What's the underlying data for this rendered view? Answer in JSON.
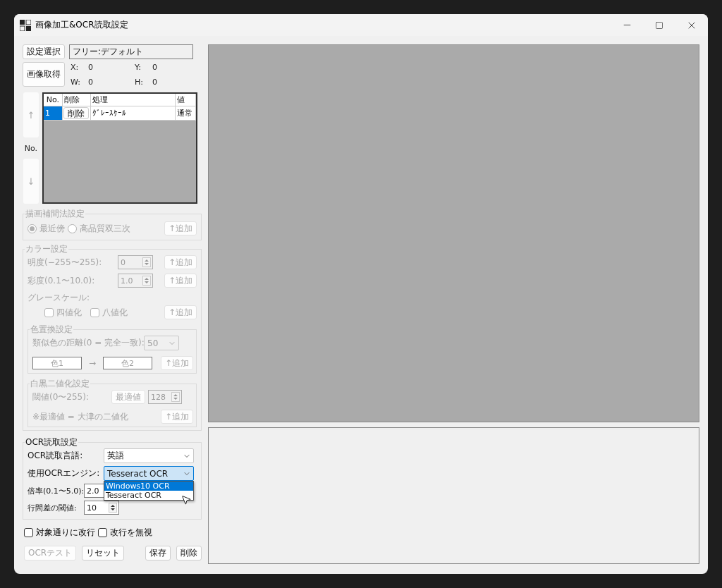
{
  "window": {
    "title": "画像加工&OCR読取設定"
  },
  "settings": {
    "select_button": "設定選択",
    "preset": "フリー:デフォルト",
    "capture_button": "画像取得",
    "coords": [
      {
        "label": "X:",
        "value": "0"
      },
      {
        "label": "Y:",
        "value": "0"
      },
      {
        "label": "W:",
        "value": "0"
      },
      {
        "label": "H:",
        "value": "0"
      }
    ]
  },
  "order": {
    "up": "↑",
    "label": "No.",
    "down": "↓",
    "disabled": true
  },
  "table": {
    "columns": [
      "No.",
      "削除",
      "処理",
      "値"
    ],
    "rows": [
      {
        "no": "1",
        "delete": "削除",
        "process": "ｸﾞﾚｰｽｹｰﾙ",
        "value": "通常",
        "selected": true
      }
    ]
  },
  "interpolation": {
    "title": "描画補間法設定",
    "disabled": true,
    "options": [
      {
        "label": "最近傍",
        "selected": true
      },
      {
        "label": "高品質双三次",
        "selected": false
      }
    ],
    "add": "↑追加"
  },
  "color": {
    "title": "カラー設定",
    "disabled": true,
    "brightness": {
      "label": "明度(−255〜255):",
      "value": "0",
      "add": "↑追加"
    },
    "saturation": {
      "label": "彩度(0.1〜10.0):",
      "value": "1.0",
      "add": "↑追加"
    },
    "grayscale": {
      "label": "グレースケール:",
      "options": [
        {
          "label": "四値化",
          "checked": false
        },
        {
          "label": "八値化",
          "checked": false
        }
      ],
      "add": "↑追加"
    },
    "replace": {
      "title": "色置換設定",
      "distance_label": "類似色の距離(0 = 完全一致):",
      "distance": "50",
      "color1": "色1",
      "arrow": "→",
      "color2": "色2",
      "add": "↑追加"
    },
    "binarize": {
      "title": "白黒二値化設定",
      "threshold_label": "閾値(0〜255):",
      "optimal": "最適値",
      "threshold": "128",
      "note": "※最適値 = 大津の二値化",
      "add": "↑追加"
    }
  },
  "ocr": {
    "title": "OCR読取設定",
    "language_label": "OCR読取言語:",
    "language": "英語",
    "engine_label": "使用OCRエンジン:",
    "engine": "Tesseract OCR",
    "engine_open": true,
    "engine_options": [
      {
        "label": "Windows10 OCR",
        "selected": true
      },
      {
        "label": "Tesseract OCR",
        "selected": false
      }
    ],
    "scale_label": "倍率(0.1〜5.0):",
    "scale": "2.0",
    "line_gap_label": "行間差の閾値:",
    "line_gap": "10"
  },
  "options": [
    {
      "label": "対象通りに改行",
      "checked": false
    },
    {
      "label": "改行を無視",
      "checked": false
    }
  ],
  "buttons": [
    {
      "label": "OCRテスト",
      "disabled": true
    },
    {
      "label": "リセット",
      "disabled": false
    },
    {
      "label": "保存",
      "disabled": false
    },
    {
      "label": "削除",
      "disabled": false
    }
  ]
}
